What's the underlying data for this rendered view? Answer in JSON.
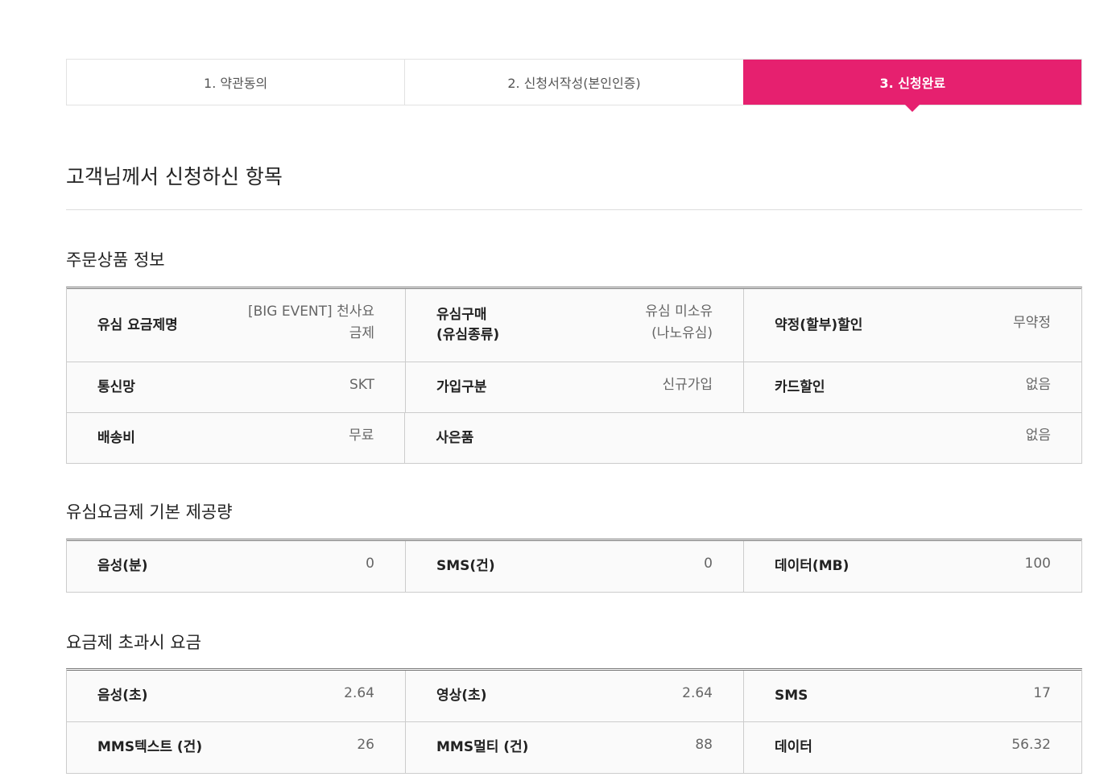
{
  "steps": [
    {
      "label": "1. 약관동의"
    },
    {
      "label": "2. 신청서작성(본인인증)"
    },
    {
      "label": "3. 신청완료"
    }
  ],
  "page_title": "고객님께서 신청하신 항목",
  "order": {
    "title": "주문상품 정보",
    "rows": [
      [
        {
          "label": "유심 요금제명",
          "value": "[BIG EVENT] 천사요\n금제"
        },
        {
          "label": "유심구매\n(유심종류)",
          "value": "유심 미소유\n(나노유심)"
        },
        {
          "label": "약정(할부)할인",
          "value": "무약정"
        }
      ],
      [
        {
          "label": "통신망",
          "value": "SKT"
        },
        {
          "label": "가입구분",
          "value": "신규가입"
        },
        {
          "label": "카드할인",
          "value": "없음"
        }
      ],
      [
        {
          "label": "배송비",
          "value": "무료"
        },
        {
          "label": "사은품",
          "value": "없음"
        }
      ]
    ]
  },
  "basic": {
    "title": "유심요금제 기본 제공량",
    "rows": [
      [
        {
          "label": "음성(분)",
          "value": "0"
        },
        {
          "label": "SMS(건)",
          "value": "0"
        },
        {
          "label": "데이터(MB)",
          "value": "100"
        }
      ]
    ]
  },
  "overage": {
    "title": "요금제 초과시 요금",
    "rows": [
      [
        {
          "label": "음성(초)",
          "value": "2.64"
        },
        {
          "label": "영상(초)",
          "value": "2.64"
        },
        {
          "label": "SMS",
          "value": "17"
        }
      ],
      [
        {
          "label": "MMS텍스트 (건)",
          "value": "26"
        },
        {
          "label": "MMS멀티 (건)",
          "value": "88"
        },
        {
          "label": "데이터",
          "value": "56.32"
        }
      ]
    ]
  }
}
